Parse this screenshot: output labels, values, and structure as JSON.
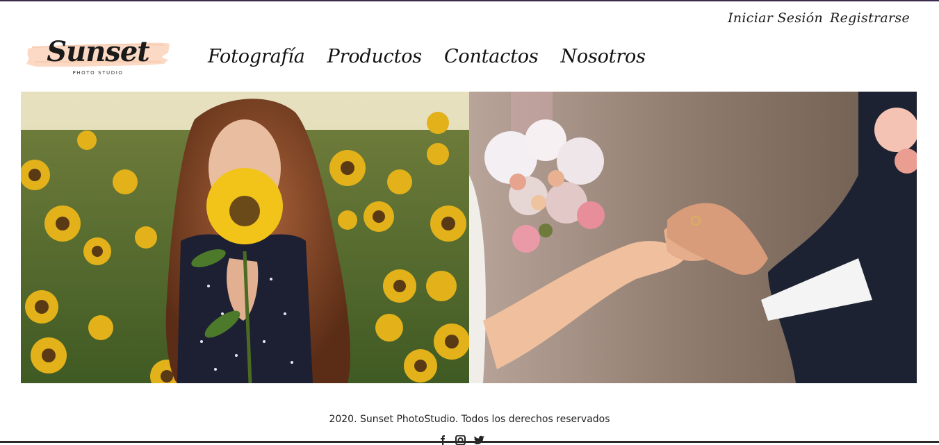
{
  "header": {
    "auth_links": [
      "Iniciar Sesión",
      "Registrarse"
    ],
    "logo": {
      "title": "Sunset",
      "subtitle": "PHOTO STUDIO"
    },
    "nav": [
      "Fotografía",
      "Productos",
      "Contactos",
      "Nosotros"
    ]
  },
  "hero": {
    "images": [
      {
        "name": "sunflower-portrait"
      },
      {
        "name": "wedding-ring-hands"
      }
    ]
  },
  "footer": {
    "copyright": "2020. Sunset PhotoStudio. Todos los derechos reservados",
    "social_icons": [
      "facebook-icon",
      "instagram-icon",
      "twitter-icon"
    ]
  },
  "colors": {
    "logo_brush": "#fbd9c4",
    "text": "#1b1b1b"
  }
}
